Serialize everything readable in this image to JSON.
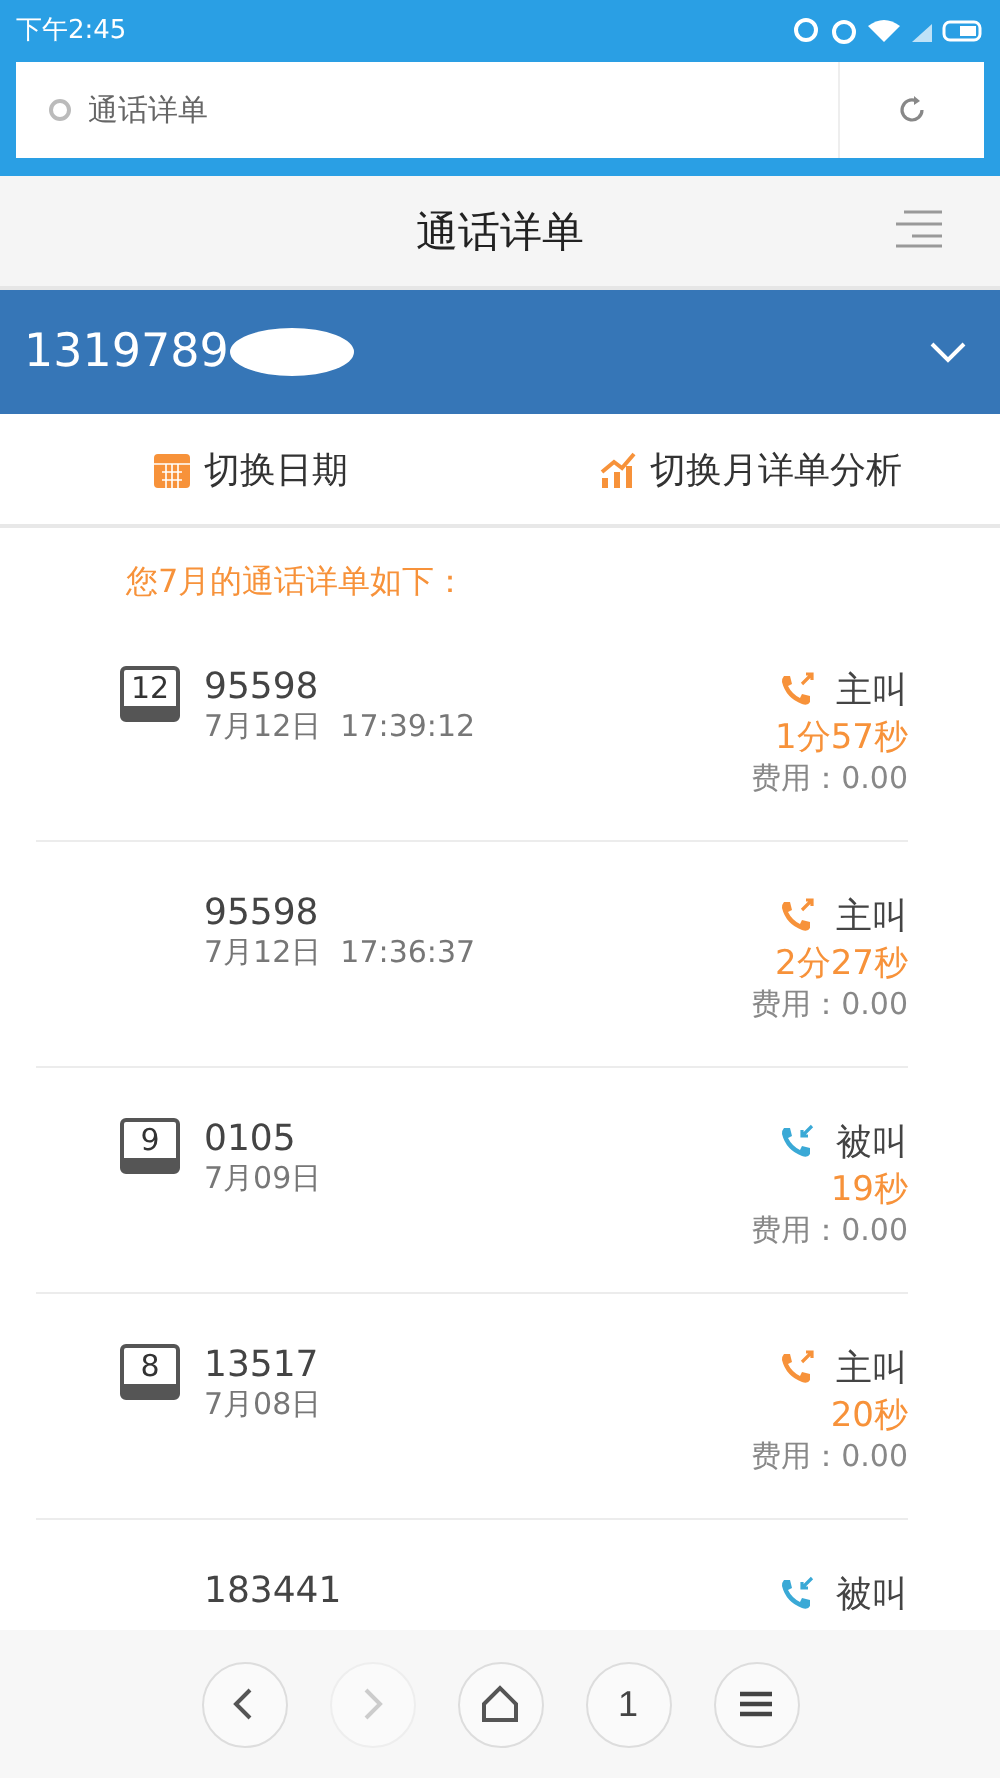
{
  "status_bar": {
    "time": "下午2:45"
  },
  "address_bar": {
    "value": "通话详单"
  },
  "title_bar": {
    "title": "通话详单"
  },
  "account": {
    "number": "1319789",
    "redacted": true
  },
  "actions": [
    {
      "kind": "calendar",
      "label": "切换日期"
    },
    {
      "kind": "chart",
      "label": "切换月详单分析"
    }
  ],
  "heading": "您7月的通话详单如下：",
  "calls": [
    {
      "day": "12",
      "number": "95598",
      "date": "7月12日",
      "time": "17:39:12",
      "kind": "outgoing",
      "type": "主叫",
      "duration": "1分57秒",
      "fee": "费用：0.00"
    },
    {
      "number": "95598",
      "date": "7月12日",
      "time": "17:36:37",
      "kind": "outgoing",
      "type": "主叫",
      "duration": "2分27秒",
      "fee": "费用：0.00"
    },
    {
      "day": "9",
      "number": "0105",
      "date": "7月09日",
      "kind": "incoming",
      "type": "被叫",
      "duration": "19秒",
      "fee": "费用：0.00"
    },
    {
      "day": "8",
      "number": "13517",
      "date": "7月08日",
      "kind": "outgoing",
      "type": "主叫",
      "duration": "20秒",
      "fee": "费用：0.00"
    },
    {
      "number": "183441",
      "kind": "incoming",
      "type": "被叫"
    }
  ],
  "nav": [
    {
      "kind": "back",
      "disabled": false
    },
    {
      "kind": "forward",
      "disabled": true
    },
    {
      "kind": "home",
      "disabled": false
    },
    {
      "kind": "tabs",
      "label": "1",
      "disabled": false
    },
    {
      "kind": "menu",
      "disabled": false
    }
  ]
}
